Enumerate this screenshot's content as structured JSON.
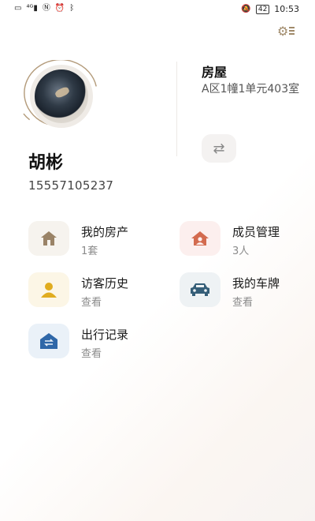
{
  "status_bar": {
    "left_icons": [
      "sim-icon",
      "signal-icon",
      "nfc-icon",
      "alarm-icon",
      "bluetooth-icon"
    ],
    "battery": "42",
    "time": "10:53"
  },
  "profile": {
    "name": "胡彬",
    "phone": "15557105237"
  },
  "house": {
    "title": "房屋",
    "address": "A区1幢1单元403室"
  },
  "tiles": [
    {
      "title": "我的房产",
      "sub": "1套",
      "icon": "house-icon",
      "bg": "#f6f3ee",
      "color": "#9a8367"
    },
    {
      "title": "成员管理",
      "sub": "3人",
      "icon": "members-house-icon",
      "bg": "#fcefee",
      "color": "#d36b4f"
    },
    {
      "title": "访客历史",
      "sub": "查看",
      "icon": "visitor-icon",
      "bg": "#fcf6e6",
      "color": "#e0ac1f"
    },
    {
      "title": "我的车牌",
      "sub": "查看",
      "icon": "car-icon",
      "bg": "#eef2f4",
      "color": "#355e78"
    },
    {
      "title": "出行记录",
      "sub": "查看",
      "icon": "transit-icon",
      "bg": "#eaf1f8",
      "color": "#2f67a8"
    }
  ],
  "colors": {
    "accent_gold": "#a08a6a"
  }
}
